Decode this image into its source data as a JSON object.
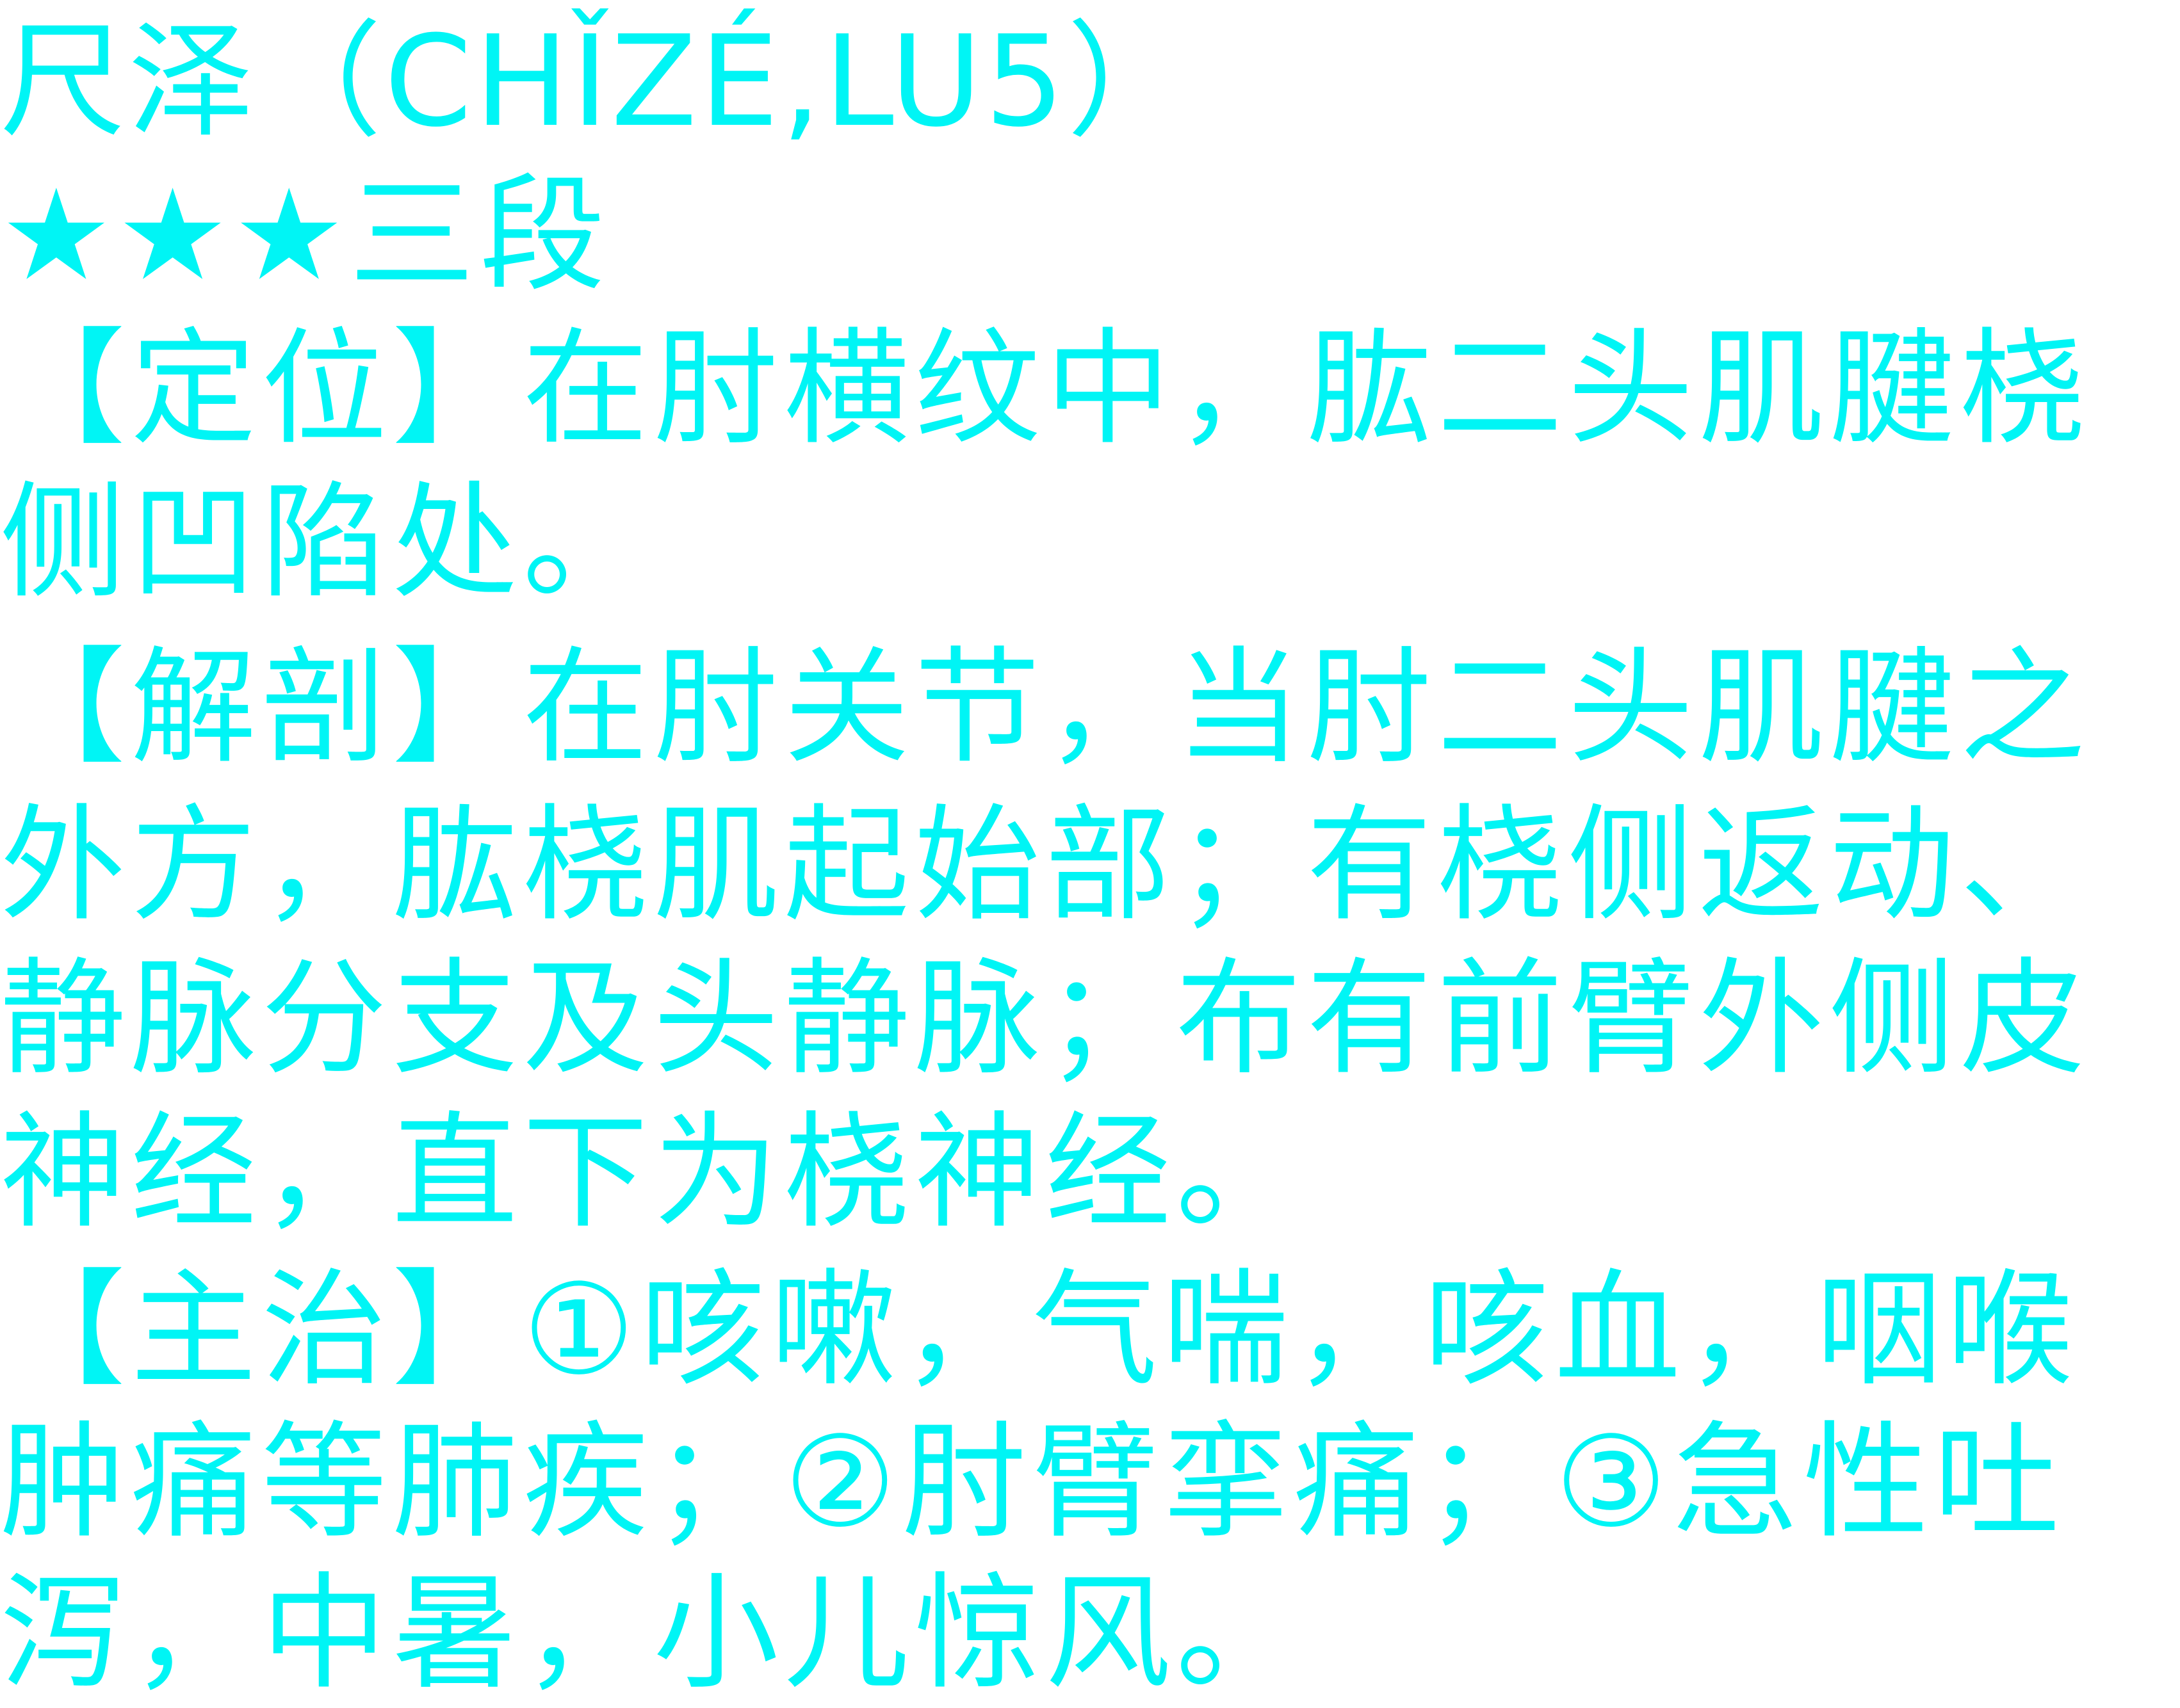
{
  "title": "尺泽（CHǏZÉ,LU5）",
  "rating": {
    "stars": "★★★",
    "label": "三段"
  },
  "lines": [
    "【定位】在肘横纹中，肱二头肌腱桡",
    "侧凹陷处。",
    "【解剖】在肘关节，当肘二头肌腱之",
    "外方，肱桡肌起始部；有桡侧返动、",
    "静脉分支及头静脉；布有前臂外侧皮",
    "神经，直下为桡神经。",
    "【主治】①咳嗽，气喘，咳血，咽喉",
    "肿痛等肺疾；②肘臂挛痛；③急性吐",
    "泻，中暑，小儿惊风。"
  ],
  "colors": {
    "text": "#00f5f5",
    "background": "#ffffff"
  }
}
